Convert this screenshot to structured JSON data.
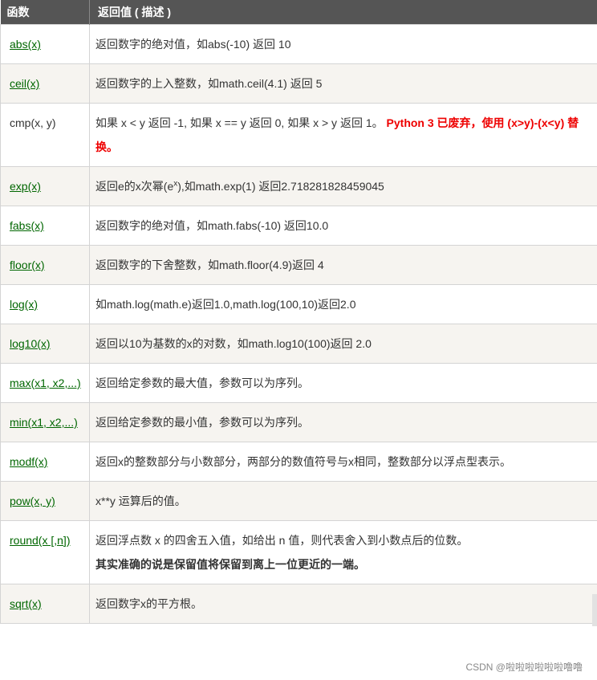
{
  "header": {
    "col_func": "函数",
    "col_desc": "返回值 ( 描述 )"
  },
  "rows": [
    {
      "func": "abs(x)",
      "desc": "返回数字的绝对值，如abs(-10) 返回 10"
    },
    {
      "func": "ceil(x)",
      "desc": "返回数字的上入整数，如math.ceil(4.1) 返回 5"
    },
    {
      "func": "cmp(x, y)",
      "desc": "如果 x < y 返回 -1, 如果 x == y 返回 0, 如果 x > y 返回 1。",
      "note": "Python 3 已废弃，使用 (x>y)-(x<y) 替换。"
    },
    {
      "func": "exp(x)",
      "desc_pre": "返回e的x次幂(e",
      "desc_sup": "x",
      "desc_post": "),如math.exp(1) 返回2.718281828459045"
    },
    {
      "func": "fabs(x)",
      "desc": "返回数字的绝对值，如math.fabs(-10) 返回10.0"
    },
    {
      "func": "floor(x)",
      "desc": "返回数字的下舍整数，如math.floor(4.9)返回 4"
    },
    {
      "func": "log(x)",
      "desc": "如math.log(math.e)返回1.0,math.log(100,10)返回2.0"
    },
    {
      "func": "log10(x)",
      "desc": "返回以10为基数的x的对数，如math.log10(100)返回 2.0"
    },
    {
      "func": "max(x1, x2,...)",
      "desc": "返回给定参数的最大值，参数可以为序列。"
    },
    {
      "func": "min(x1, x2,...)",
      "desc": "返回给定参数的最小值，参数可以为序列。"
    },
    {
      "func": "modf(x)",
      "desc": "返回x的整数部分与小数部分，两部分的数值符号与x相同，整数部分以浮点型表示。"
    },
    {
      "func": "pow(x, y)",
      "desc": "x**y 运算后的值。"
    },
    {
      "func": "round(x [,n])",
      "desc": "返回浮点数 x 的四舍五入值，如给出 n 值，则代表舍入到小数点后的位数。",
      "note": "其实准确的说是保留值将保留到离上一位更近的一端。"
    },
    {
      "func": "sqrt(x)",
      "desc": "返回数字x的平方根。"
    }
  ],
  "watermark": "CSDN @啦啦啦啦啦啦噜噜"
}
